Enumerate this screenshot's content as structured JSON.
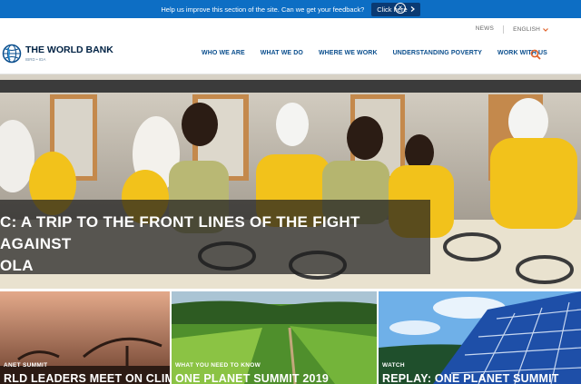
{
  "banner": {
    "message": "Help us improve this section of the site. Can we get your feedback?",
    "button_label": "Click here",
    "close_glyph": "×",
    "background": "#0d6ec4"
  },
  "utility": {
    "news": "NEWS",
    "language": "ENGLISH"
  },
  "logo": {
    "name": "THE WORLD BANK",
    "sub": "IBRD • IDA"
  },
  "nav": {
    "items": [
      "WHO WE ARE",
      "WHAT WE DO",
      "WHERE WE WORK",
      "UNDERSTANDING POVERTY",
      "WORK WITH US"
    ]
  },
  "hero": {
    "title_line1": "C: A TRIP TO THE FRONT LINES OF THE FIGHT AGAINST",
    "title_line2": "OLA"
  },
  "cards": [
    {
      "label": "ANET SUMMIT",
      "title": "RLD LEADERS MEET ON CLIMATE"
    },
    {
      "label": "WHAT YOU NEED TO KNOW",
      "title": "ONE PLANET SUMMIT 2019"
    },
    {
      "label": "WATCH",
      "title": "REPLAY: ONE PLANET SUMMIT"
    }
  ],
  "colors": {
    "brand_navy": "#002244",
    "nav_blue": "#0a4e8d",
    "search_orange": "#e0622a"
  },
  "icons": [
    "globe-logo-icon",
    "chevron-right-icon",
    "close-icon",
    "chevron-down-icon",
    "search-icon"
  ]
}
